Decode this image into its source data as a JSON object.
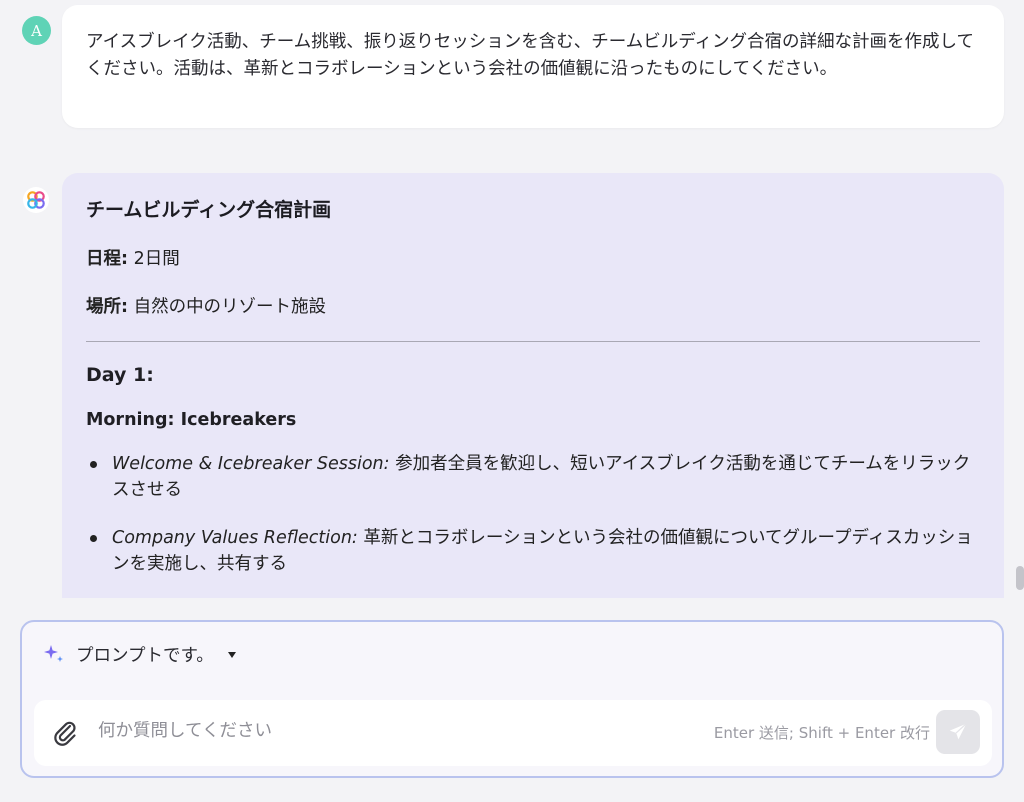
{
  "user_message": {
    "avatar_letter": "A",
    "text": "アイスブレイク活動、チーム挑戦、振り返りセッションを含む、チームビルディング合宿の詳細な計画を作成してください。活動は、革新とコラボレーションという会社の価値観に沿ったものにしてください。"
  },
  "ai_message": {
    "title": "チームビルディング合宿計画",
    "schedule_label": "日程:",
    "schedule_value": " 2日間",
    "location_label": "場所:",
    "location_value": " 自然の中のリゾート施設",
    "day_heading": "Day 1:",
    "session_heading": "Morning: Icebreakers",
    "bullets": [
      {
        "title": "Welcome & Icebreaker Session:",
        "text": " 参加者全員を歓迎し、短いアイスブレイク活動を通じてチームをリラックスさせる"
      },
      {
        "title": "Company Values Reflection:",
        "text": " 革新とコラボレーションという会社の価値観についてグループディスカッションを実施し、共有する"
      }
    ]
  },
  "composer": {
    "prompt_selector_label": "プロンプトです。",
    "input_placeholder": "何か質問してください",
    "input_value": "",
    "send_hint": "Enter 送信; Shift + Enter 改行"
  },
  "icons": {
    "prompt_icon": "sparkle-icon",
    "attach_icon": "paperclip-icon",
    "send_icon": "paper-plane-icon",
    "ai_avatar_icon": "multicolor-flower-icon"
  },
  "colors": {
    "user_avatar": "#5fd3b6",
    "ai_bubble": "#e9e7f8",
    "composer_border": "#b9c3ee",
    "sparkle": "#7b6cf0"
  }
}
